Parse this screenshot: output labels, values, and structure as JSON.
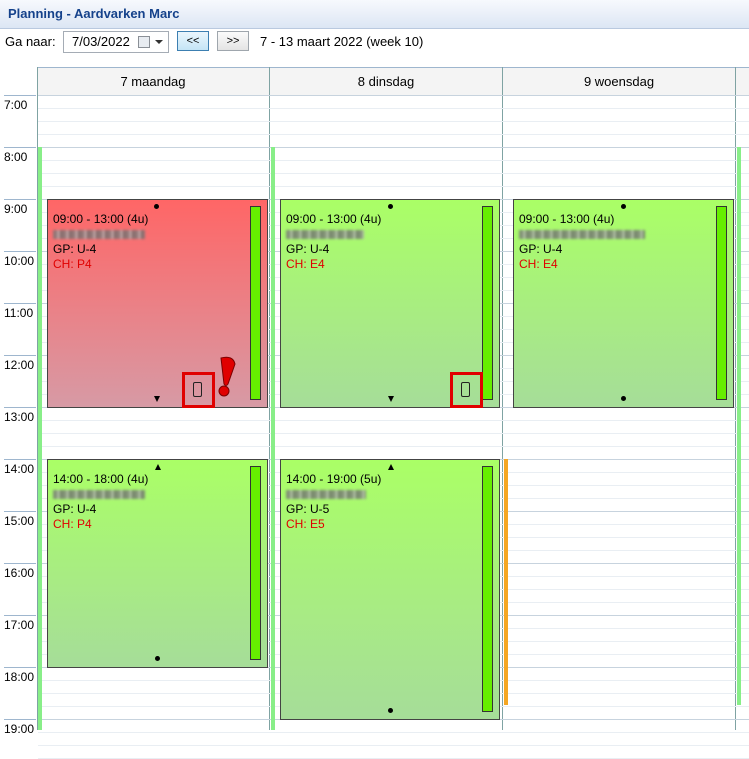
{
  "window": {
    "title": "Planning - Aardvarken Marc"
  },
  "toolbar": {
    "goto_label": "Ga naar:",
    "date_value": "7/03/2022",
    "prev_label": "<<",
    "next_label": ">>",
    "range_text": "7 - 13 maart 2022 (week 10)"
  },
  "days": [
    {
      "label": "7 maandag"
    },
    {
      "label": "8 dinsdag"
    },
    {
      "label": "9 woensdag"
    }
  ],
  "hours": [
    "7:00",
    "8:00",
    "9:00",
    "10:00",
    "11:00",
    "12:00",
    "13:00",
    "14:00",
    "15:00",
    "16:00",
    "17:00",
    "18:00",
    "19:00"
  ],
  "appointments": [
    {
      "time": "09:00 - 13:00 (4u)",
      "gp": "GP: U-4",
      "ch": "CH: P4",
      "status": "warning"
    },
    {
      "time": "09:00 - 13:00 (4u)",
      "gp": "GP: U-4",
      "ch": "CH: E4",
      "status": "ok"
    },
    {
      "time": "09:00 - 13:00 (4u)",
      "gp": "GP: U-4",
      "ch": "CH: E4",
      "status": "ok"
    },
    {
      "time": "14:00 - 18:00 (4u)",
      "gp": "GP: U-4",
      "ch": "CH: P4",
      "status": "ok"
    },
    {
      "time": "14:00 - 19:00 (5u)",
      "gp": "GP: U-5",
      "ch": "CH: E5",
      "status": "ok"
    }
  ],
  "colors": {
    "accent": "#15428b",
    "warning_appt_top": "#ff6666",
    "ok_appt_top": "#aaff66",
    "progress_green": "#66ee00",
    "availability_green": "#88ee88",
    "availability_orange": "#f5a623",
    "highlight_red": "#e00000"
  },
  "icons": [
    "calendar-icon",
    "dropdown-icon",
    "phone-icon",
    "exclamation-icon"
  ]
}
